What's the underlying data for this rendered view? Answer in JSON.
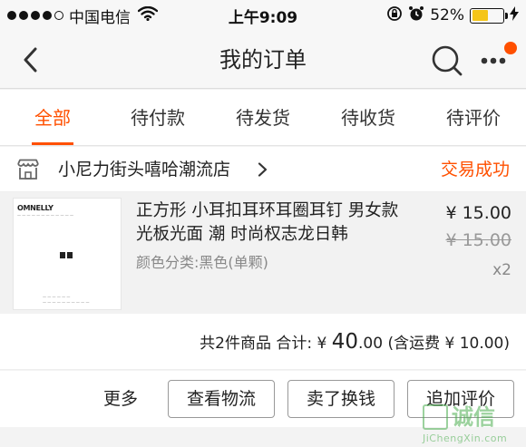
{
  "status_bar": {
    "carrier": "中国电信",
    "time": "上午9:09",
    "battery": "52%",
    "battery_level": 0.52
  },
  "nav": {
    "title": "我的订单"
  },
  "tabs": [
    {
      "label": "全部",
      "active": true
    },
    {
      "label": "待付款",
      "active": false
    },
    {
      "label": "待发货",
      "active": false
    },
    {
      "label": "待收货",
      "active": false
    },
    {
      "label": "待评价",
      "active": false
    }
  ],
  "store": {
    "name": "小尼力街头嘻哈潮流店",
    "status": "交易成功"
  },
  "item": {
    "thumb_brand": "OMNELLY",
    "title": "正方形 小耳扣耳环耳圈耳钉 男女款 光板光面 潮 时尚权志龙日韩",
    "sku": "颜色分类:黑色(单颗)",
    "price": "¥ 15.00",
    "original_price": "¥ 15.00",
    "quantity": "x2"
  },
  "summary": {
    "count_text": "共2件商品 合计: ¥",
    "total_int": "40",
    "total_dec": ".00",
    "shipping_text": "(含运费 ¥ 10.00)"
  },
  "actions": {
    "more": "更多",
    "logistics": "查看物流",
    "sell": "卖了换钱",
    "review": "追加评价"
  },
  "watermark": {
    "cn": "诚信",
    "en": "JiChengXin.com"
  },
  "colors": {
    "accent": "#ff5000",
    "battery": "#f5c518"
  }
}
